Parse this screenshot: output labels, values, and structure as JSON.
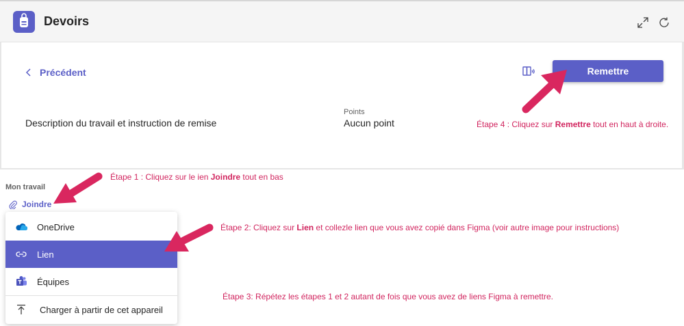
{
  "header": {
    "title": "Devoirs",
    "icons": [
      "backpack-icon",
      "expand-icon",
      "refresh-icon"
    ]
  },
  "nav": {
    "back_label": "Précédent"
  },
  "toolbar": {
    "reader_icon": "immersive-reader-icon",
    "submit_label": "Remettre"
  },
  "assignment": {
    "description": "Description du travail et instruction de remise",
    "points_label": "Points",
    "points_value": "Aucun point"
  },
  "my_work": {
    "label": "Mon travail",
    "attach_label": "Joindre"
  },
  "attach_menu": {
    "items": [
      {
        "label": "OneDrive",
        "icon": "onedrive-icon",
        "selected": false
      },
      {
        "label": "Lien",
        "icon": "link-icon",
        "selected": true
      },
      {
        "label": "Équipes",
        "icon": "teams-icon",
        "selected": false
      },
      {
        "label": "Charger à partir de cet appareil",
        "icon": "upload-icon",
        "selected": false
      }
    ]
  },
  "annotations": {
    "step4_prefix": "Étape 4 : Cliquez sur ",
    "step4_bold": "Remettre",
    "step4_suffix": " tout en haut à droite.",
    "step1_prefix": "Étape 1 : Cliquez sur le ien ",
    "step1_bold": "Joindre",
    "step1_suffix": " tout en bas",
    "step2_prefix": "Étape 2: Cliquez sur ",
    "step2_bold": "Lien",
    "step2_suffix": " et collezle lien que vous avez copié dans Figma (voir autre image pour instructions)",
    "step3": "Étape 3: Répétez les étapes 1 et 2 autant de fois que vous avez de liens Figma à remettre."
  },
  "colors": {
    "accent": "#5b5fc7",
    "annotation": "#d1245e"
  }
}
